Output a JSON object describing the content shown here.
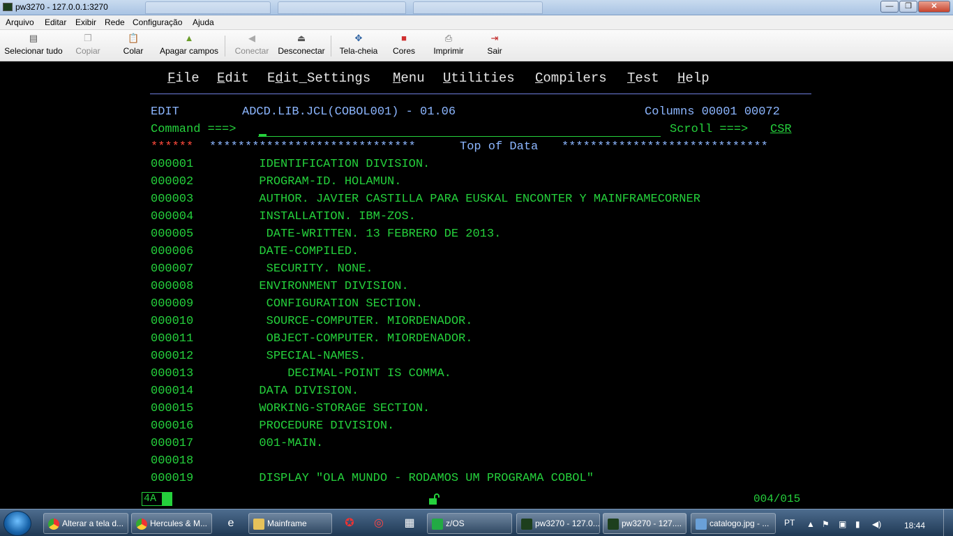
{
  "window": {
    "title": "pw3270 - 127.0.0.1:3270",
    "buttons": {
      "minimize": "—",
      "maximize": "❐",
      "close": "✕"
    }
  },
  "menubar": [
    "Arquivo",
    "Editar",
    "Exibir",
    "Rede",
    "Configuração",
    "Ajuda"
  ],
  "toolbar": {
    "select_all": "Selecionar tudo",
    "copy": "Copiar",
    "paste": "Colar",
    "erase_fields": "Apagar campos",
    "connect": "Conectar",
    "disconnect": "Desconectar",
    "fullscreen": "Tela-cheia",
    "colors": "Cores",
    "print": "Imprimir",
    "exit": "Sair"
  },
  "ispf": {
    "menu": [
      {
        "first": "F",
        "rest": "ile"
      },
      {
        "first": "E",
        "rest": "dit"
      },
      {
        "first": "E",
        "mid": "d",
        "rest": "it_Settings"
      },
      {
        "first": "M",
        "rest": "enu"
      },
      {
        "first": "U",
        "rest": "tilities"
      },
      {
        "first": "C",
        "rest": "ompilers"
      },
      {
        "first": "T",
        "rest": "est"
      },
      {
        "first": "H",
        "rest": "elp"
      }
    ],
    "mode": "EDIT",
    "dataset": "ADCD.LIB.JCL(COBOL001) - 01.06",
    "columns": "Columns 00001 00072",
    "command_label": "Command ===>",
    "command_value": "",
    "scroll_label": "Scroll ===>",
    "scroll_value": "CSR",
    "top_marker_red": "******",
    "top_marker_left": "*****************************",
    "top_marker_text": "Top of Data",
    "top_marker_right": "*****************************",
    "lines": [
      {
        "num": "000001",
        "text": "       IDENTIFICATION DIVISION."
      },
      {
        "num": "000002",
        "text": "       PROGRAM-ID. HOLAMUN."
      },
      {
        "num": "000003",
        "text": "       AUTHOR. JAVIER CASTILLA PARA EUSKAL ENCONTER Y MAINFRAMECORNER"
      },
      {
        "num": "000004",
        "text": "       INSTALLATION. IBM-ZOS."
      },
      {
        "num": "000005",
        "text": "        DATE-WRITTEN. 13 FEBRERO DE 2013."
      },
      {
        "num": "000006",
        "text": "       DATE-COMPILED."
      },
      {
        "num": "000007",
        "text": "        SECURITY. NONE."
      },
      {
        "num": "000008",
        "text": "       ENVIRONMENT DIVISION."
      },
      {
        "num": "000009",
        "text": "        CONFIGURATION SECTION."
      },
      {
        "num": "000010",
        "text": "        SOURCE-COMPUTER. MIORDENADOR."
      },
      {
        "num": "000011",
        "text": "        OBJECT-COMPUTER. MIORDENADOR."
      },
      {
        "num": "000012",
        "text": "        SPECIAL-NAMES."
      },
      {
        "num": "000013",
        "text": "           DECIMAL-POINT IS COMMA."
      },
      {
        "num": "000014",
        "text": "       DATA DIVISION."
      },
      {
        "num": "000015",
        "text": "       WORKING-STORAGE SECTION."
      },
      {
        "num": "000016",
        "text": "       PROCEDURE DIVISION."
      },
      {
        "num": "000017",
        "text": "       001-MAIN."
      },
      {
        "num": "000018",
        "text": ""
      },
      {
        "num": "000019",
        "text": "       DISPLAY \"OLA MUNDO - RODAMOS UM PROGRAMA COBOL\""
      }
    ]
  },
  "status": {
    "indicator": "4A",
    "position": "004/015"
  },
  "taskbar": {
    "tasks": [
      "Alterar a tela d...",
      "Hercules & M...",
      "Mainframe",
      "z/OS",
      "pw3270 - 127.0...",
      "pw3270 - 127....",
      "catalogo.jpg - ..."
    ],
    "language": "PT",
    "clock": "18:44"
  },
  "colors": {
    "field_blue": "#8cb6ff",
    "text_green": "#25d13c",
    "marker_red": "#ff4a3c",
    "background": "#000000"
  }
}
